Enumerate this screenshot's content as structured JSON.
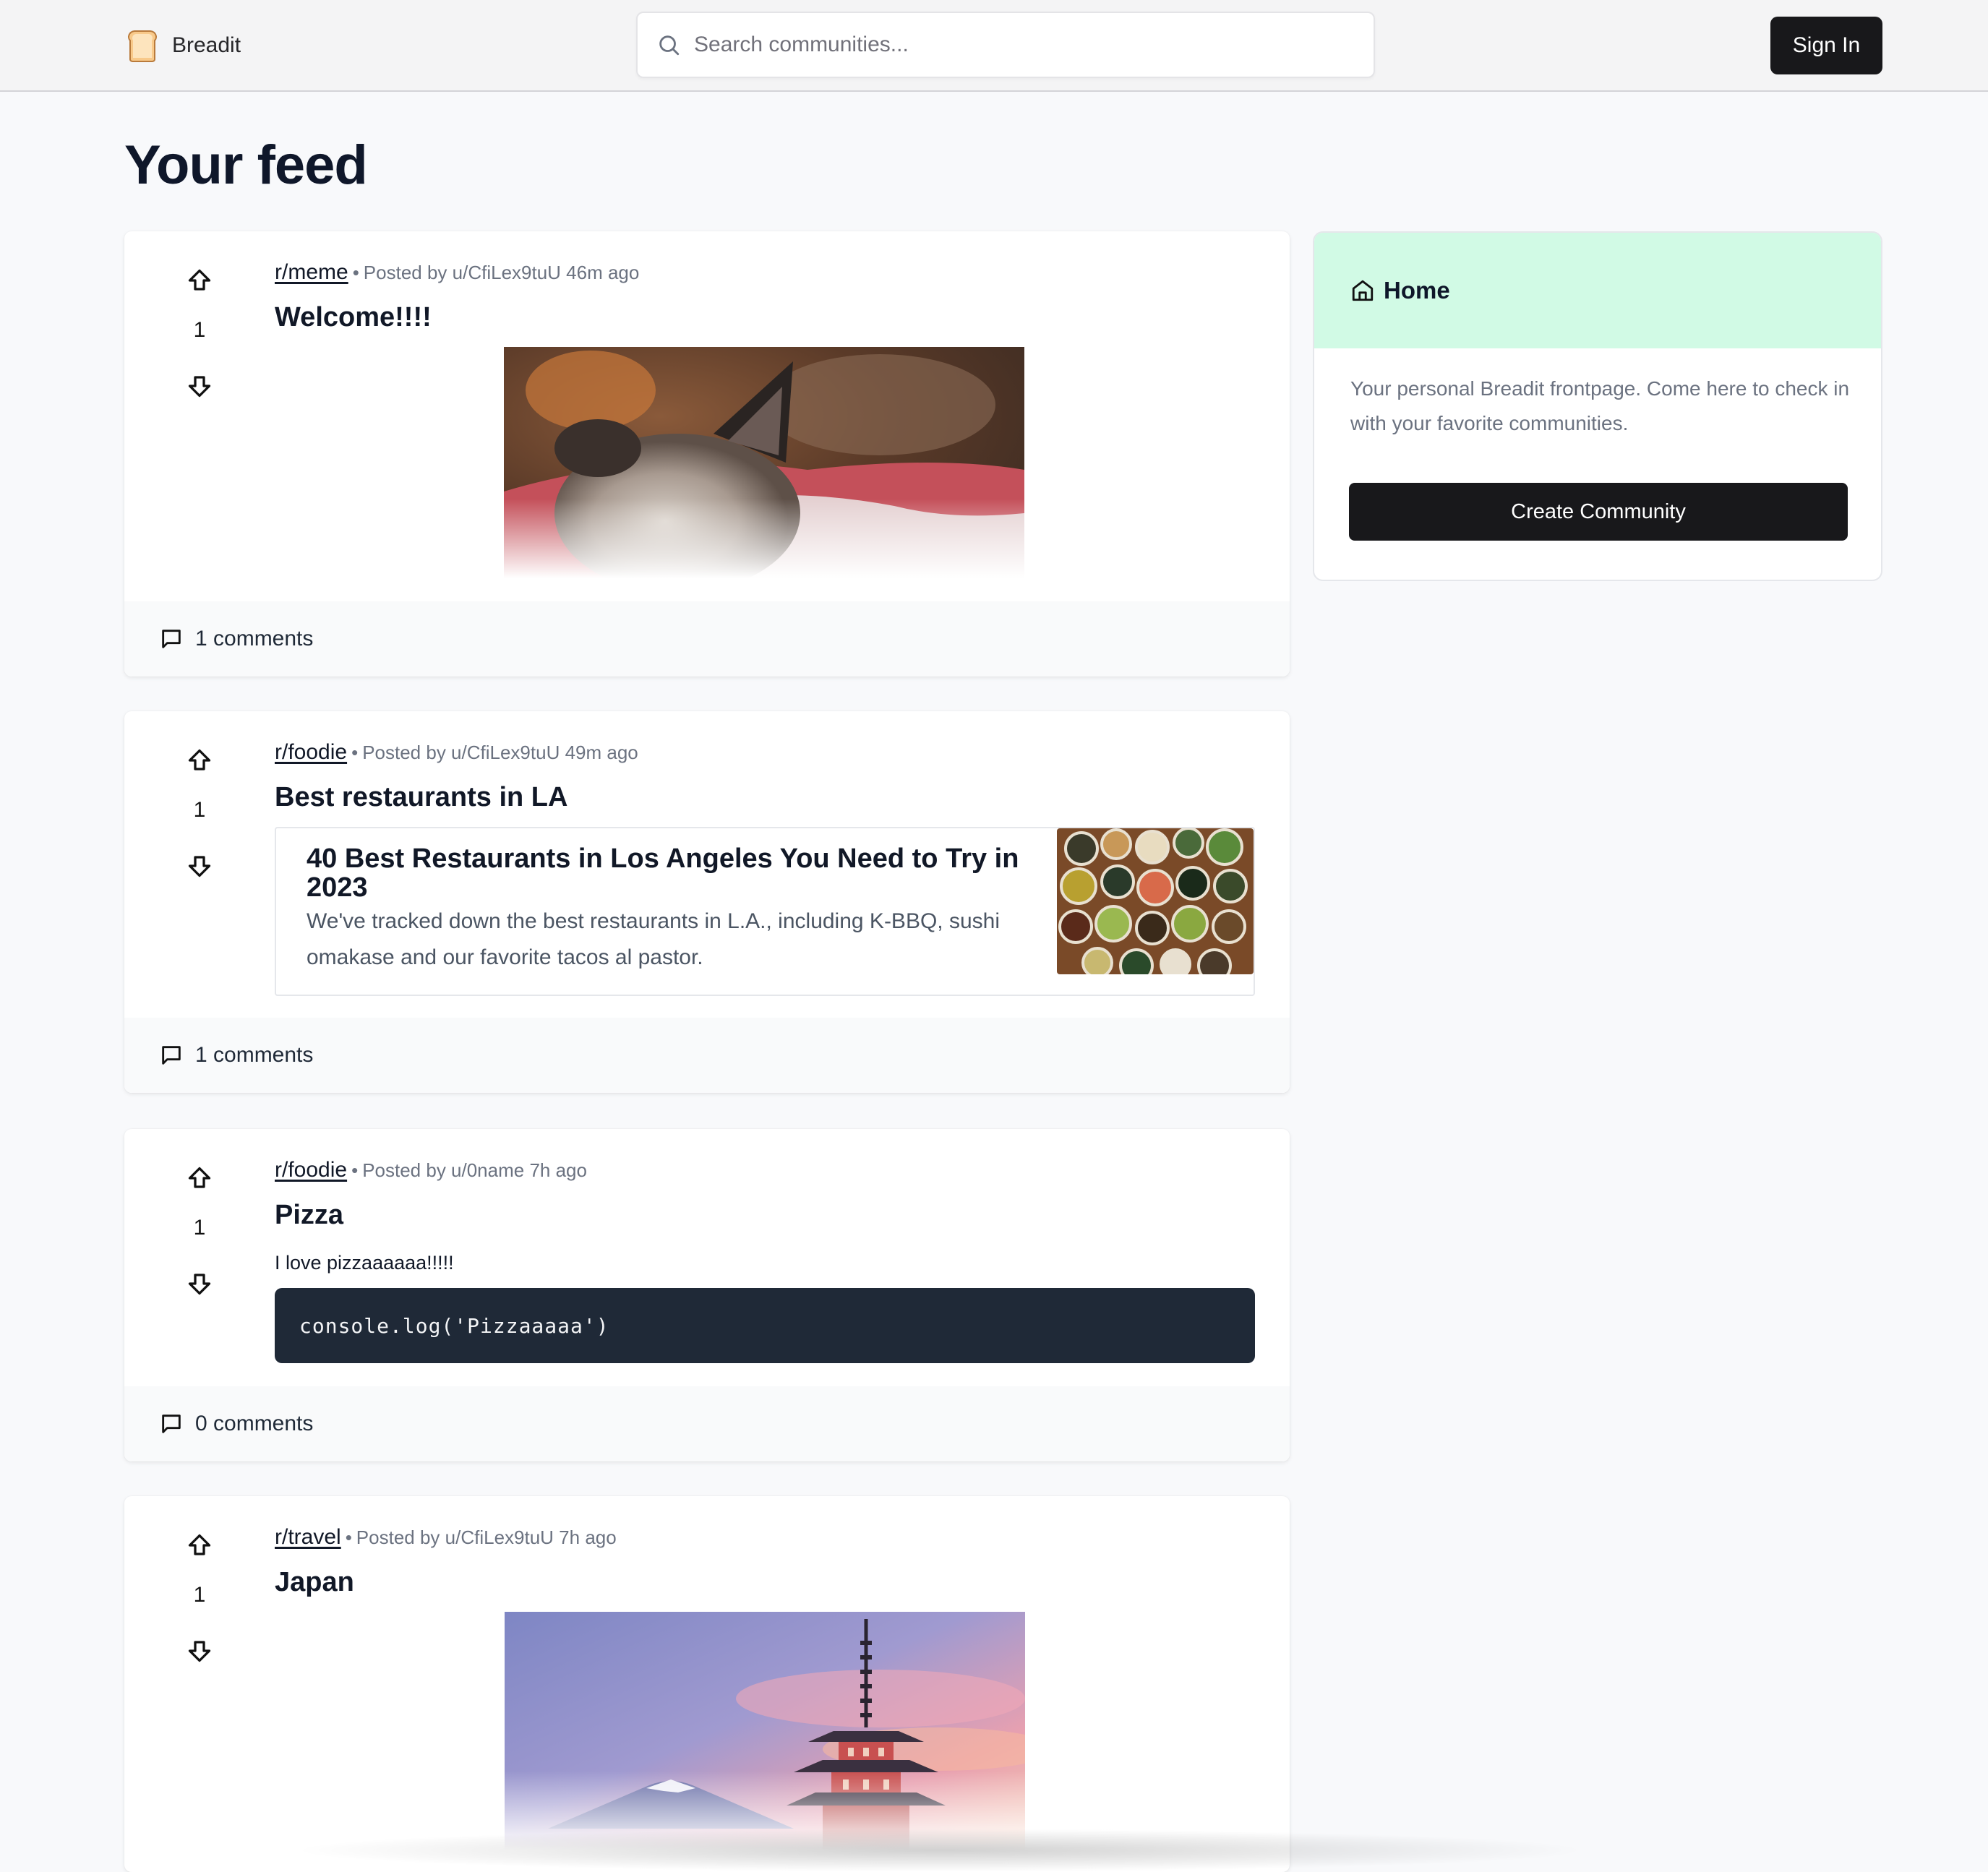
{
  "navbar": {
    "brand": "Breadit",
    "search_placeholder": "Search communities...",
    "signin_label": "Sign In"
  },
  "page": {
    "title": "Your feed"
  },
  "posts": [
    {
      "subreddit": "r/meme",
      "meta": "Posted by u/CfiLex9tuU 46m ago",
      "title": "Welcome!!!!",
      "votes": "1",
      "comments": "1 comments"
    },
    {
      "subreddit": "r/foodie",
      "meta": "Posted by u/CfiLex9tuU 49m ago",
      "title": "Best restaurants in LA",
      "votes": "1",
      "comments": "1 comments",
      "link_title": "40 Best Restaurants in Los Angeles You Need to Try in 2023",
      "link_desc": "We've tracked down the best restaurants in L.A., including K-BBQ, sushi omakase and our favorite tacos al pastor."
    },
    {
      "subreddit": "r/foodie",
      "meta": "Posted by u/0name 7h ago",
      "title": "Pizza",
      "votes": "1",
      "comments": "0 comments",
      "text": "I love pizzaaaaaa!!!!!",
      "code": "console.log('Pizzaaaaa')"
    },
    {
      "subreddit": "r/travel",
      "meta": "Posted by u/CfiLex9tuU 7h ago",
      "title": "Japan",
      "votes": "1"
    }
  ],
  "sidebar": {
    "title": "Home",
    "description": "Your personal Breadit frontpage. Come here to check in with your favorite communities.",
    "button_label": "Create Community"
  }
}
